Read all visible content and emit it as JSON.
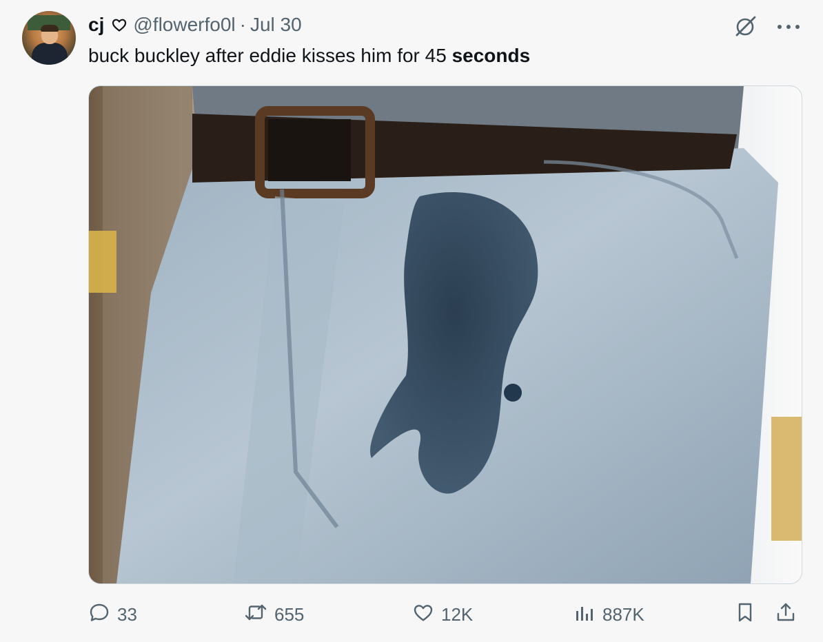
{
  "tweet": {
    "display_name": "cj",
    "handle": "@flowerfo0l",
    "separator": "·",
    "date": "Jul 30",
    "text_prefix": "buck buckley after eddie kisses him for 45 ",
    "text_bold": "seconds"
  },
  "stats": {
    "replies": "33",
    "reposts": "655",
    "likes": "12K",
    "views": "887K"
  },
  "media": {
    "alt": "Photo of light-wash jeans with a large dark wet stain on the front"
  },
  "icons": {
    "heart_outline": "heart-outline-icon",
    "grok": "grok-icon",
    "more": "more-icon",
    "reply": "reply-icon",
    "repost": "repost-icon",
    "like": "like-icon",
    "views": "views-icon",
    "bookmark": "bookmark-icon",
    "share": "share-icon"
  },
  "colors": {
    "background": "#f7f7f7",
    "text": "#0f1419",
    "muted": "#536471",
    "border": "#cfd9de"
  }
}
